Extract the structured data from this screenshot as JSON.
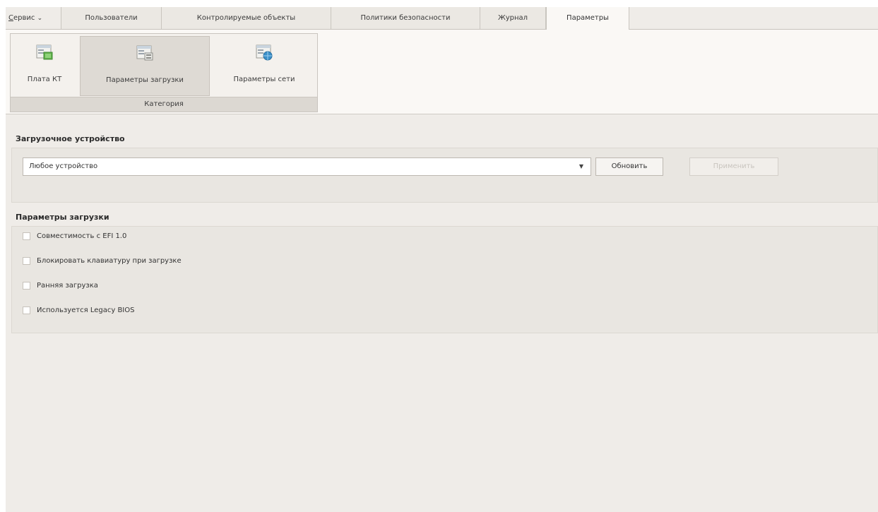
{
  "menu": {
    "service_label": "Сервис",
    "service_underline": "С",
    "service_rest": "ервис",
    "service_arrow": "⌄"
  },
  "tabs": [
    {
      "label": "Пользователи"
    },
    {
      "label": "Контролируемые объекты"
    },
    {
      "label": "Политики безопасности"
    },
    {
      "label": "Журнал"
    },
    {
      "label": "Параметры",
      "active": true
    }
  ],
  "ribbon": {
    "buttons": [
      {
        "label": "Плата КТ",
        "icon": "board-icon"
      },
      {
        "label": "Параметры загрузки",
        "icon": "boot-settings-icon",
        "selected": true
      },
      {
        "label": "Параметры сети",
        "icon": "network-settings-icon"
      }
    ],
    "group_caption": "Категория"
  },
  "boot_device": {
    "title": "Загрузочное устройство",
    "selected_value": "Любое устройство",
    "refresh_label": "Обновить",
    "apply_label": "Применить"
  },
  "boot_params": {
    "title": "Параметры загрузки",
    "options": [
      {
        "label": "Совместимость с EFI 1.0",
        "checked": false
      },
      {
        "label": "Блокировать клавиатуру при загрузке",
        "checked": false
      },
      {
        "label": "Ранняя загрузка",
        "checked": false
      },
      {
        "label": "Используется Legacy BIOS",
        "checked": false
      }
    ]
  },
  "colors": {
    "window_bg": "#efece8",
    "ribbon_bg": "#faf8f5",
    "icon_green": "#5fb04a",
    "icon_blue": "#3a8fc9"
  }
}
